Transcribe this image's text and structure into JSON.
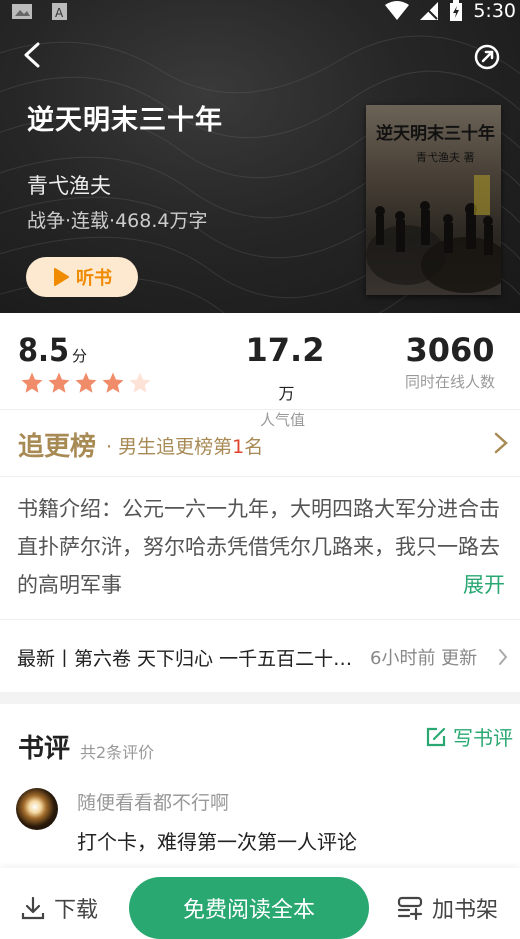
{
  "status_bar": {
    "time": "5:30"
  },
  "book": {
    "title": "逆天明末三十年",
    "author": "青弋渔夫",
    "meta": "战争·连载·468.4万字",
    "listen_label": "听书",
    "cover_title": "逆天明末三十年",
    "cover_author": "青弋渔夫 著"
  },
  "stats": {
    "score": "8.5",
    "score_unit": "分",
    "rating_stars": 4,
    "rating_max": 5,
    "popularity": "17.2",
    "popularity_unit": "万",
    "popularity_label": "人气值",
    "online": "3060",
    "online_label": "同时在线人数"
  },
  "rank": {
    "title": "追更榜",
    "sub_prefix": "· 男生追更榜第",
    "position": "1",
    "sub_suffix": "名"
  },
  "intro": {
    "text": "书籍介绍：公元一六一九年，大明四路大军分进合击直扑萨尔浒，努尔哈赤凭借凭尔几路来，我只一路去的高明军事",
    "expand_label": "展开"
  },
  "latest": {
    "text": "最新丨第六卷 天下归心  一千五百二十…",
    "time": "6小时前 更新"
  },
  "reviews": {
    "title": "书评",
    "count": "共2条评价",
    "write_label": "写书评",
    "items": [
      {
        "user": "随便看看都不行啊",
        "text": "打个卡，难得第一次第一人评论"
      }
    ]
  },
  "bottom": {
    "download_label": "下载",
    "read_label": "免费阅读全本",
    "shelf_label": "加书架"
  },
  "colors": {
    "accent_green": "#2aa872",
    "rank_gold": "#a88a55",
    "star": "#f08c6a",
    "listen_orange": "#f08a00"
  }
}
